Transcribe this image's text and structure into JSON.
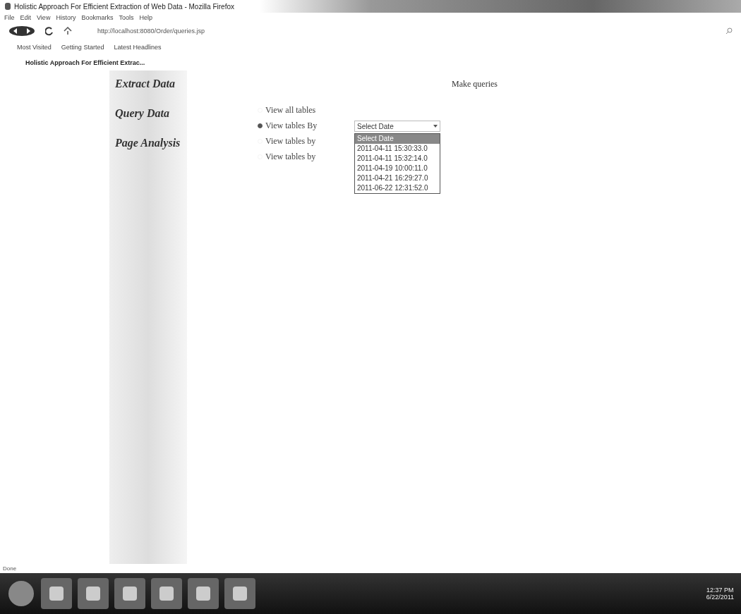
{
  "window": {
    "title": "Holistic Approach For Efficient Extraction of Web Data - Mozilla Firefox"
  },
  "menu": [
    "File",
    "Edit",
    "View",
    "History",
    "Bookmarks",
    "Tools",
    "Help"
  ],
  "address": {
    "value": "http://localhost:8080/Order/queries.jsp"
  },
  "bookmarks": [
    "Most Visited",
    "Getting Started",
    "Latest Headlines"
  ],
  "tabs": [
    {
      "label": "Holistic Approach For Efficient Extrac...",
      "selected": true
    }
  ],
  "sidebar": {
    "items": [
      "Extract Data",
      "Query Data",
      "Page Analysis"
    ]
  },
  "main": {
    "heading": "Make queries",
    "options": [
      {
        "label": "View all tables",
        "selected": false
      },
      {
        "label": "View tables By",
        "selected": true
      },
      {
        "label": "View tables by",
        "selected": false
      },
      {
        "label": "View tables by",
        "selected": false
      }
    ],
    "select": {
      "value": "Select Date",
      "expanded": true,
      "options": [
        {
          "label": "Select Date",
          "selected": true
        },
        {
          "label": "2011-04-11 15:30:33.0",
          "selected": false
        },
        {
          "label": "2011-04-11 15:32:14.0",
          "selected": false
        },
        {
          "label": "2011-04-19 10:00:11.0",
          "selected": false
        },
        {
          "label": "2011-04-21 16:29:27.0",
          "selected": false
        },
        {
          "label": "2011-06-22 12:31:52.0",
          "selected": false
        }
      ]
    }
  },
  "status_bar": {
    "text": "Done"
  },
  "taskbar": {
    "time": "12:37 PM",
    "date": "6/22/2011"
  }
}
